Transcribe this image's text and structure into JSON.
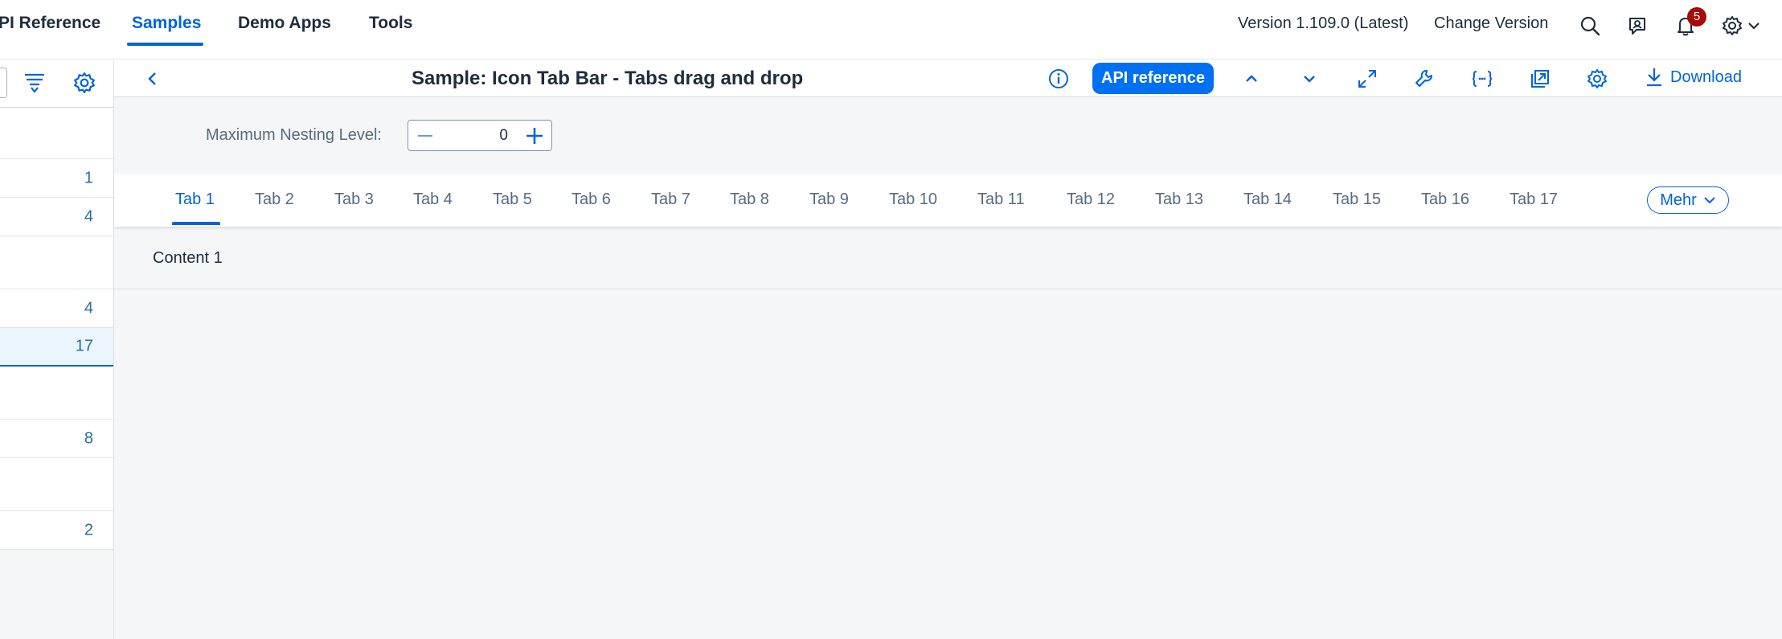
{
  "shell": {
    "nav": [
      "PI Reference",
      "Samples",
      "Demo Apps",
      "Tools"
    ],
    "version": "Version 1.109.0 (Latest)",
    "change_version": "Change Version",
    "notification_count": "5"
  },
  "sidebar": {
    "rows": [
      {
        "count": "1"
      },
      {
        "count": "4"
      },
      {
        "count": ""
      },
      {
        "count": "4"
      },
      {
        "count": "17"
      },
      {
        "count": ""
      },
      {
        "count": "8"
      },
      {
        "count": ""
      },
      {
        "count": "2"
      }
    ]
  },
  "main": {
    "title": "Sample: Icon Tab Bar - Tabs drag and drop",
    "api_reference": "API reference",
    "download": "Download",
    "nesting_label": "Maximum Nesting Level:",
    "nesting_value": "0",
    "tabs": [
      "Tab 1",
      "Tab 2",
      "Tab 3",
      "Tab 4",
      "Tab 5",
      "Tab 6",
      "Tab 7",
      "Tab 8",
      "Tab 9",
      "Tab 10",
      "Tab 11",
      "Tab 12",
      "Tab 13",
      "Tab 14",
      "Tab 15",
      "Tab 16",
      "Tab 17"
    ],
    "more": "Mehr",
    "content": "Content 1"
  },
  "colors": {
    "accent": "#0064d9",
    "button": "#0070f2",
    "badge": "#aa0808"
  }
}
